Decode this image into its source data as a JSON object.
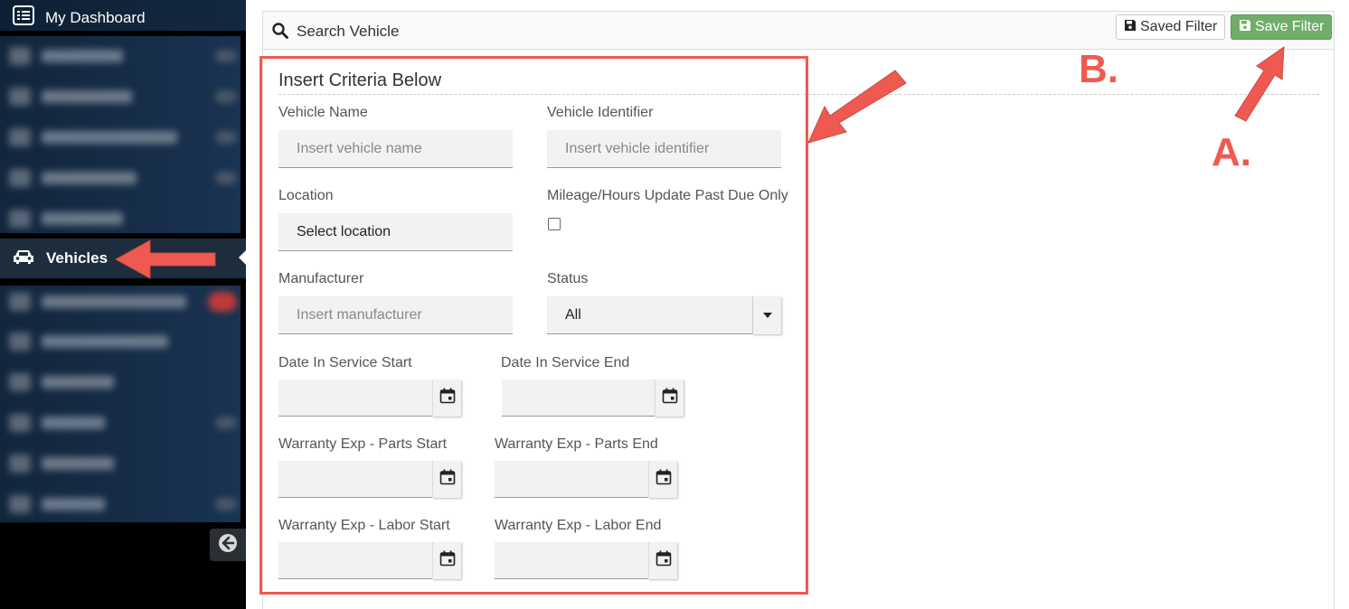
{
  "sidebar": {
    "dashboard_label": "My Dashboard",
    "active_label": "Vehicles"
  },
  "search": {
    "title": "Search Vehicle",
    "saved_filter_label": "Saved Filter",
    "save_filter_label": "Save Filter"
  },
  "criteria": {
    "title": "Insert Criteria Below",
    "vehicle_name_label": "Vehicle Name",
    "vehicle_name_placeholder": "Insert vehicle name",
    "vehicle_identifier_label": "Vehicle Identifier",
    "vehicle_identifier_placeholder": "Insert vehicle identifier",
    "location_label": "Location",
    "location_value": "Select location",
    "mileage_label": "Mileage/Hours Update Past Due Only",
    "manufacturer_label": "Manufacturer",
    "manufacturer_placeholder": "Insert manufacturer",
    "status_label": "Status",
    "status_value": "All",
    "date_service_start_label": "Date In Service Start",
    "date_service_end_label": "Date In Service End",
    "warranty_parts_start_label": "Warranty Exp - Parts Start",
    "warranty_parts_end_label": "Warranty Exp - Parts End",
    "warranty_labor_start_label": "Warranty Exp - Labor Start",
    "warranty_labor_end_label": "Warranty Exp - Labor End"
  },
  "annotations": {
    "a_label": "A.",
    "b_label": "B.",
    "color": "#ef5a50"
  },
  "colors": {
    "save_button": "#6fae68",
    "sidebar_bg": "#0e2035"
  }
}
